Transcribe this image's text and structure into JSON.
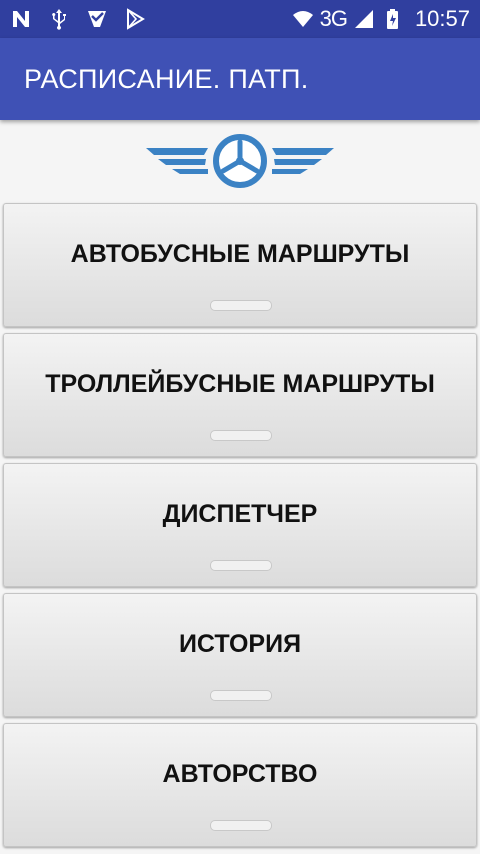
{
  "status_bar": {
    "icons": [
      "n-icon",
      "usb-icon",
      "checkmark-icon",
      "play-store-icon"
    ],
    "network": "3G",
    "time": "10:57",
    "colors": {
      "background": "#303f9f"
    }
  },
  "app_bar": {
    "title": "РАСПИСАНИЕ. ПАТП.",
    "colors": {
      "background": "#3f51b5"
    }
  },
  "logo": {
    "icon": "steering-wheel-wings-logo",
    "color": "#3b82c4"
  },
  "menu": {
    "buttons": [
      {
        "label": "АВТОБУСНЫЕ МАРШРУТЫ"
      },
      {
        "label": "ТРОЛЛЕЙБУСНЫЕ МАРШРУТЫ"
      },
      {
        "label": "ДИСПЕТЧЕР"
      },
      {
        "label": "ИСТОРИЯ"
      },
      {
        "label": "АВТОРСТВО"
      }
    ]
  }
}
